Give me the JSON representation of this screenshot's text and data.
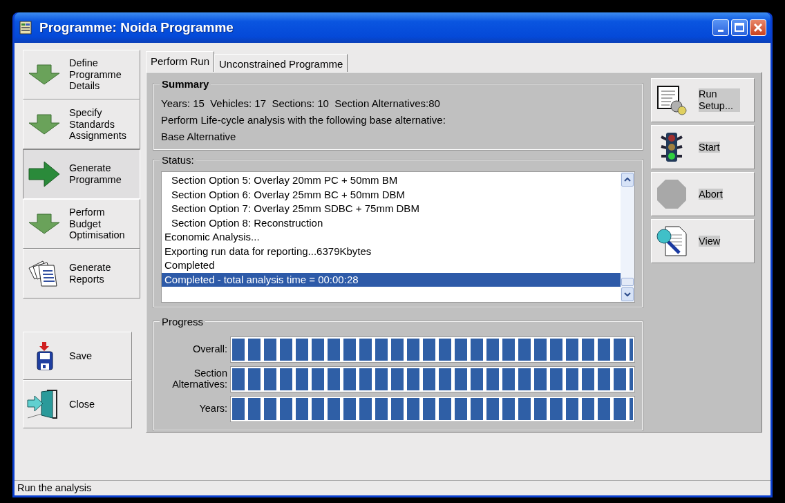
{
  "window": {
    "title": "Programme: Noida Programme"
  },
  "nav": [
    {
      "kind": "arrow",
      "label": "Define Programme Details",
      "selected": false
    },
    {
      "kind": "arrow",
      "label": "Specify Standards Assignments",
      "selected": false
    },
    {
      "kind": "arrow",
      "label": "Generate Programme",
      "selected": true
    },
    {
      "kind": "arrow",
      "label": "Perform Budget Optimisation",
      "selected": false
    },
    {
      "kind": "reports",
      "label": "Generate Reports",
      "selected": false
    }
  ],
  "file_buttons": [
    {
      "kind": "save",
      "label": "Save"
    },
    {
      "kind": "close",
      "label": "Close"
    }
  ],
  "tabs": [
    {
      "label": "Perform Run",
      "selected": true
    },
    {
      "label": "Unconstrained Programme",
      "selected": false
    }
  ],
  "summary": {
    "title": "Summary",
    "lines": [
      "Years: 15  Vehicles: 17  Sections: 10  Section Alternatives:80",
      "Perform Life-cycle analysis with the following base alternative:",
      "Base Alternative"
    ]
  },
  "status": {
    "title": "Status:",
    "items": [
      {
        "kind": "option",
        "text": "Section Option 5: Overlay 20mm PC + 50mm BM",
        "selected": false
      },
      {
        "kind": "option",
        "text": "Section Option 6: Overlay 25mm BC + 50mm DBM",
        "selected": false
      },
      {
        "kind": "option",
        "text": "Section Option 7: Overlay 25mm SDBC + 75mm DBM",
        "selected": false
      },
      {
        "kind": "option",
        "text": "Section Option 8: Reconstruction",
        "selected": false
      },
      {
        "kind": "step",
        "text": "Economic Analysis...",
        "selected": false
      },
      {
        "kind": "step",
        "text": "Exporting run data for reporting...6379Kbytes",
        "selected": false
      },
      {
        "kind": "step",
        "text": "Completed",
        "selected": false
      },
      {
        "kind": "step",
        "text": "Completed - total analysis time = 00:00:28",
        "selected": true
      }
    ]
  },
  "progress": {
    "title": "Progress",
    "bars": [
      {
        "label": "Overall:",
        "level": 1
      },
      {
        "label": "Section Alternatives:",
        "level": 1
      },
      {
        "label": "Years:",
        "level": 1
      }
    ]
  },
  "actions": [
    {
      "kind": "setup",
      "label": "Run Setup..."
    },
    {
      "kind": "start",
      "label": "Start"
    },
    {
      "kind": "abort",
      "label": "Abort"
    },
    {
      "kind": "view",
      "label": "View"
    }
  ],
  "status_bar": "Run the analysis"
}
